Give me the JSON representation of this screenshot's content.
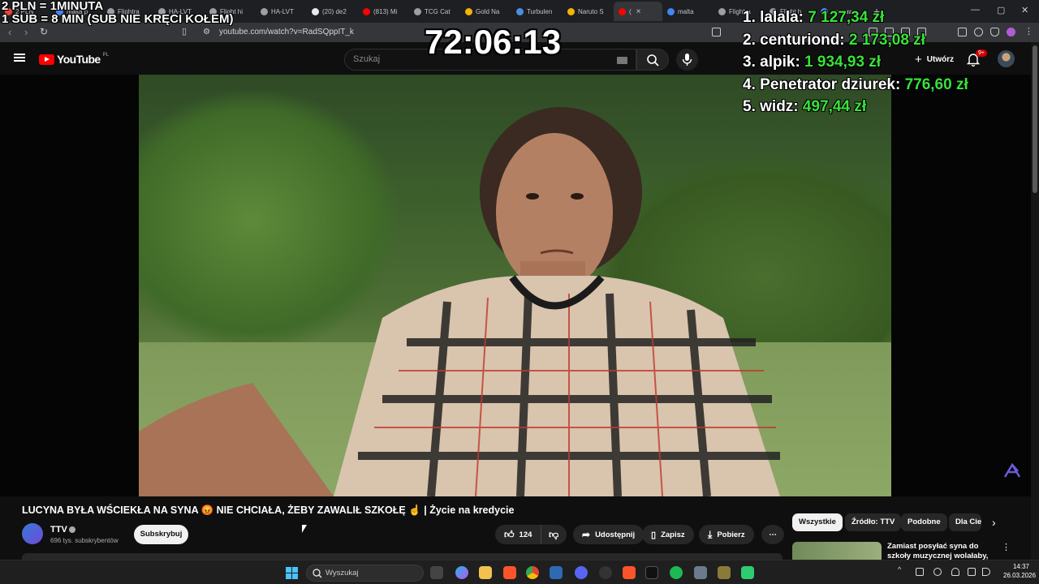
{
  "browser": {
    "tabs": [
      {
        "label": "2 PLN",
        "color": "#ea4335"
      },
      {
        "label": "malta p",
        "color": "#4285f4"
      },
      {
        "label": "Flightra",
        "color": "#9aa0a6"
      },
      {
        "label": "HA-LVT",
        "color": "#9aa0a6"
      },
      {
        "label": "Flight hi",
        "color": "#9aa0a6"
      },
      {
        "label": "HA-LVT",
        "color": "#9aa0a6"
      },
      {
        "label": "(20) de2",
        "color": "#e8eaed"
      },
      {
        "label": "(813) Mi",
        "color": "#ff0000"
      },
      {
        "label": "TCG Cat",
        "color": "#9aa0a6"
      },
      {
        "label": "Gold Na",
        "color": "#f4b400"
      },
      {
        "label": "Turbulen",
        "color": "#4a90e2"
      },
      {
        "label": "Naruto S",
        "color": "#f4b400"
      },
      {
        "label": "(",
        "color": "#ff0000"
      },
      {
        "label": "malta",
        "color": "#4285f4"
      },
      {
        "label": "Flightra",
        "color": "#9aa0a6"
      },
      {
        "label": "Flight h",
        "color": "#9aa0a6"
      },
      {
        "label": "warsaw",
        "color": "#4285f4"
      }
    ],
    "active_tab_index": 12,
    "new_tab": "+",
    "window_controls": [
      "—",
      "▢",
      "✕"
    ],
    "url": "youtube.com/watch?v=RadSQppIT_k"
  },
  "youtube": {
    "logo_text": "YouTube",
    "country_code": "PL",
    "search_placeholder": "Szukaj",
    "create_label": "Utwórz",
    "notif_badge": "9+"
  },
  "overlay": {
    "rate_line1": "2 PLN =  1MINUTA",
    "rate_line2": "1 SUB = 8 MIN (SUB NIE KRĘCI KOŁEM)",
    "timer": "72:06:13",
    "leaderboard": [
      {
        "rank": "1.",
        "name": "lalala:",
        "amount": "7 127,34 zł"
      },
      {
        "rank": "2.",
        "name": "centuriond:",
        "amount": "2 173,08 zł"
      },
      {
        "rank": "3.",
        "name": "alpik:",
        "amount": "1 934,93 zł"
      },
      {
        "rank": "4.",
        "name": "Penetrator dziurek:",
        "amount": "776,60 zł"
      },
      {
        "rank": "5.",
        "name": "widz:",
        "amount": "497,44 zł"
      }
    ]
  },
  "video": {
    "title": "LUCYNA BYŁA WŚCIEKŁA NA SYNA 😡 NIE CHCIAŁA, ŻEBY ZAWALIŁ SZKOŁĘ ☝️ | Życie na kredycie",
    "channel_name": "TTV",
    "subscribers": "696 tys. subskrybentów",
    "subscribe_label": "Subskrybuj",
    "likes": "124",
    "share_label": "Udostępnij",
    "save_label": "Zapisz",
    "download_label": "Pobierz",
    "more_label": "⋯"
  },
  "sidebar": {
    "chips": [
      "Wszystkie",
      "Źródło: TTV",
      "Podobne",
      "Dla Ciebie"
    ],
    "recommendation_title": "Zamiast posyłać syna do szkoły muzycznej wolałaby, żeby ojciec"
  },
  "taskbar": {
    "search_label": "Wyszukaj",
    "time": "14:37",
    "date": "26.03.2026"
  }
}
